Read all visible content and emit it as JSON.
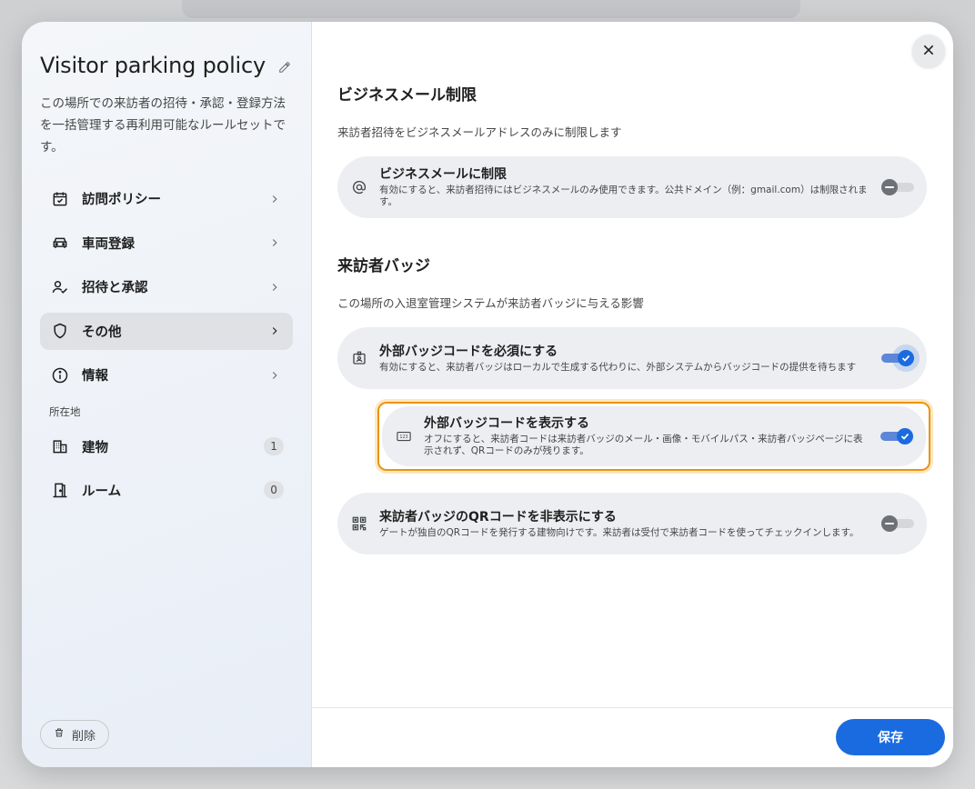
{
  "sidebar": {
    "title": "Visitor parking policy",
    "description": "この場所での来訪者の招待・承認・登録方法を一括管理する再利用可能なルールセットです。",
    "nav_items": [
      {
        "label": "訪問ポリシー",
        "icon": "calendar-check-icon"
      },
      {
        "label": "車両登録",
        "icon": "car-icon"
      },
      {
        "label": "招待と承認",
        "icon": "person-check-icon"
      },
      {
        "label": "その他",
        "icon": "shield-icon",
        "active": true
      },
      {
        "label": "情報",
        "icon": "info-icon"
      }
    ],
    "locations_label": "所在地",
    "locations": [
      {
        "label": "建物",
        "count": "1",
        "icon": "building-icon"
      },
      {
        "label": "ルーム",
        "count": "0",
        "icon": "door-icon"
      }
    ],
    "delete_label": "削除"
  },
  "main": {
    "business_email": {
      "title": "ビジネスメール制限",
      "subtitle": "来訪者招待をビジネスメールアドレスのみに制限します",
      "setting": {
        "title": "ビジネスメールに制限",
        "description": "有効にすると、来訪者招待にはビジネスメールのみ使用できます。公共ドメイン（例：gmail.com）は制限されます。",
        "enabled": false
      }
    },
    "badge": {
      "title": "来訪者バッジ",
      "subtitle": "この場所の入退室管理システムが来訪者バッジに与える影響",
      "require_external": {
        "title": "外部バッジコードを必須にする",
        "description": "有効にすると、来訪者バッジはローカルで生成する代わりに、外部システムからバッジコードの提供を待ちます",
        "enabled": true
      },
      "show_external": {
        "title": "外部バッジコードを表示する",
        "description": "オフにすると、来訪者コードは来訪者バッジのメール・画像・モバイルパス・来訪者バッジページに表示されず、QRコードのみが残ります。",
        "enabled": true
      },
      "hide_qr": {
        "title": "来訪者バッジのQRコードを非表示にする",
        "description": "ゲートが独自のQRコードを発行する建物向けです。来訪者は受付で来訪者コードを使ってチェックインします。",
        "enabled": false
      }
    }
  },
  "footer": {
    "save_label": "保存"
  },
  "colors": {
    "accent": "#1a6be0",
    "highlight": "#e8950f"
  }
}
